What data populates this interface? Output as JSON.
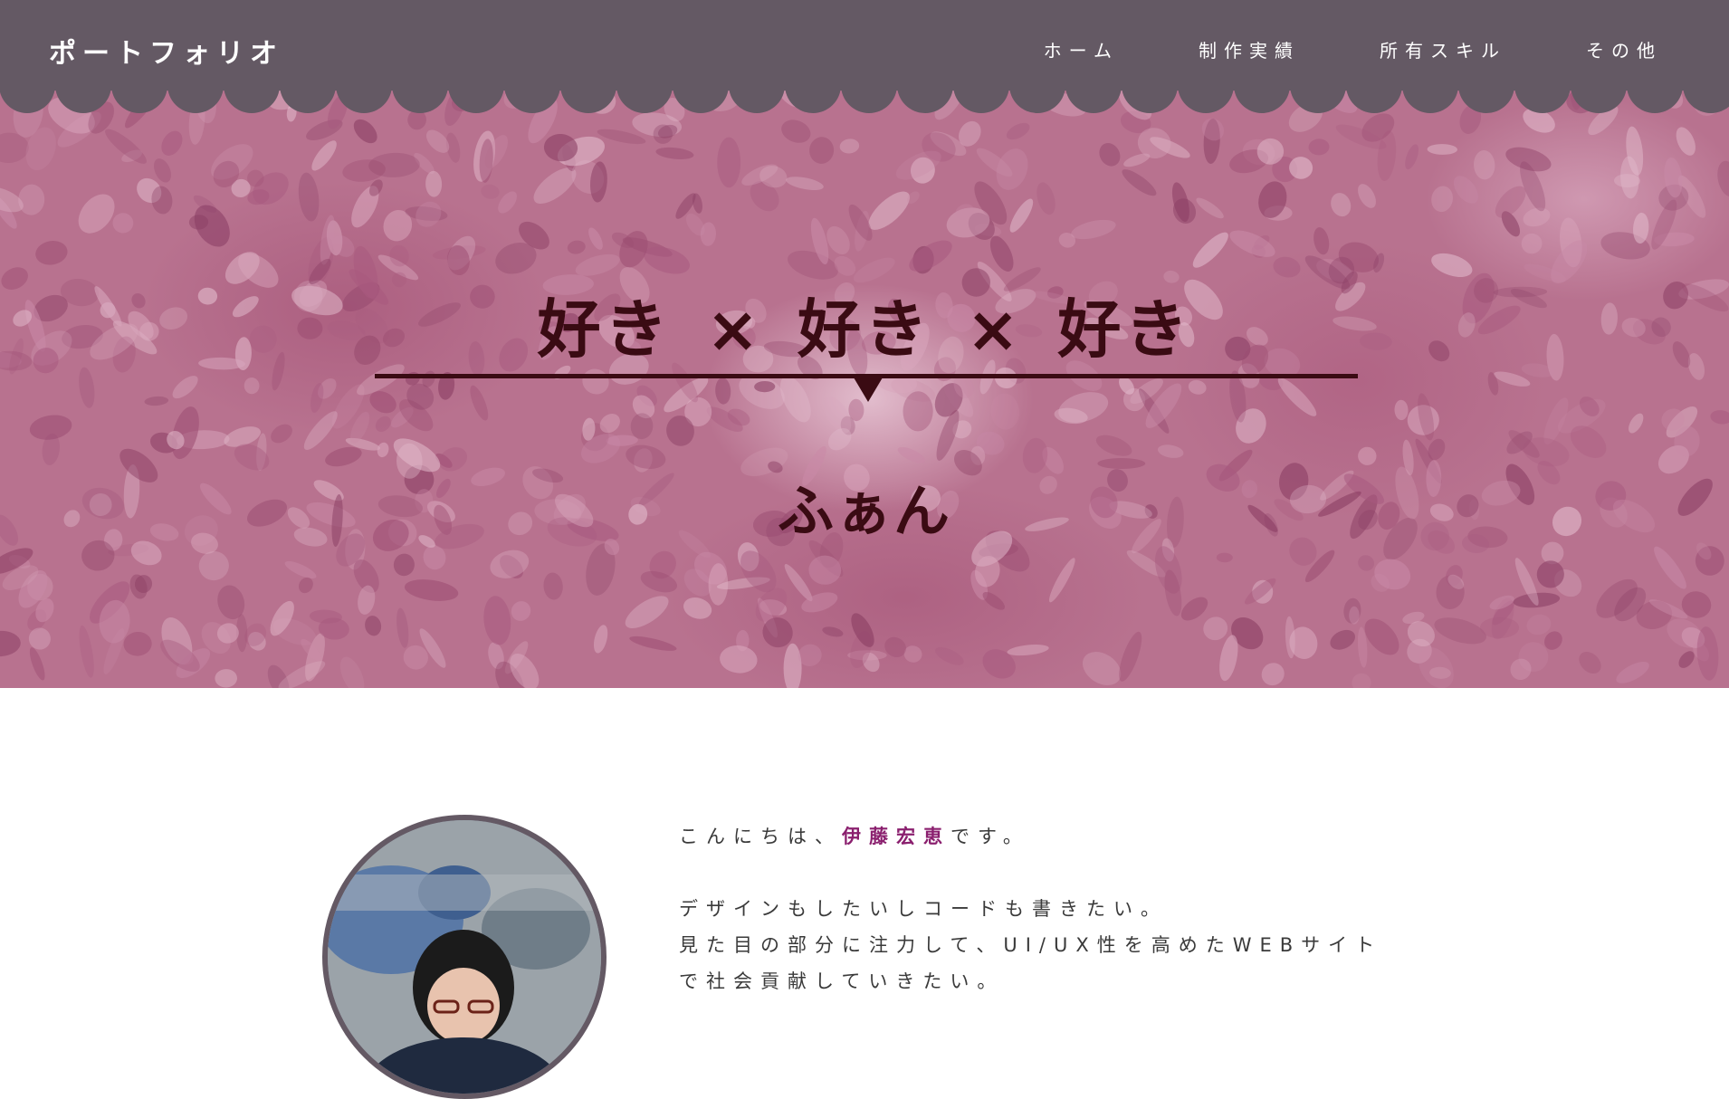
{
  "header": {
    "site_title": "ポートフォリオ",
    "nav": [
      {
        "label": "ホーム"
      },
      {
        "label": "制作実績"
      },
      {
        "label": "所有スキル"
      },
      {
        "label": "その他"
      }
    ]
  },
  "hero": {
    "catch": "好き × 好き × 好き",
    "name": "ふぁん"
  },
  "about": {
    "greeting_before": "こんにちは、",
    "greeting_name": "伊藤宏恵",
    "greeting_after": "です。",
    "line2": "デザインもしたいしコードも書きたい。",
    "line3": "見た目の部分に注力して、UI/UX性を高めたWEBサイト",
    "line4": "で社会貢献していきたい。"
  },
  "colors": {
    "header_bg": "#645964",
    "hero_base": "#b8728f",
    "hero_text": "#3a0b13",
    "accent": "#8a1f6e"
  }
}
